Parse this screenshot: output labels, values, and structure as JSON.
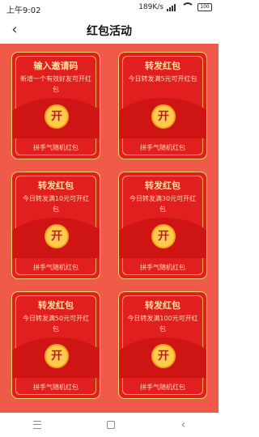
{
  "status": {
    "time": "上午9:02",
    "speed": "189K/s",
    "battery": "100"
  },
  "nav": {
    "back_icon": "chevron-left-icon",
    "title": "红包活动"
  },
  "cards": [
    {
      "title": "输入邀请码",
      "desc": "新增一个有效好友可开红包",
      "button": "开",
      "footer": "拼手气随机红包"
    },
    {
      "title": "转发红包",
      "desc": "今日转发满5元可开红包",
      "button": "开",
      "footer": "拼手气随机红包"
    },
    {
      "title": "转发红包",
      "desc": "今日转发满10元可开红包",
      "button": "开",
      "footer": "拼手气随机红包"
    },
    {
      "title": "转发红包",
      "desc": "今日转发满30元可开红包",
      "button": "开",
      "footer": "拼手气随机红包"
    },
    {
      "title": "转发红包",
      "desc": "今日转发满50元可开红包",
      "button": "开",
      "footer": "拼手气随机红包"
    },
    {
      "title": "转发红包",
      "desc": "今日转发满100元可开红包",
      "button": "开",
      "footer": "拼手气随机红包"
    }
  ],
  "bottom_nav": {
    "menu_icon": "menu-icon",
    "home_icon": "home-icon",
    "back_icon": "back-icon"
  },
  "colors": {
    "page_bg": "#f05a48",
    "card_red": "#e21f1f",
    "gold": "#ffcb4d"
  }
}
